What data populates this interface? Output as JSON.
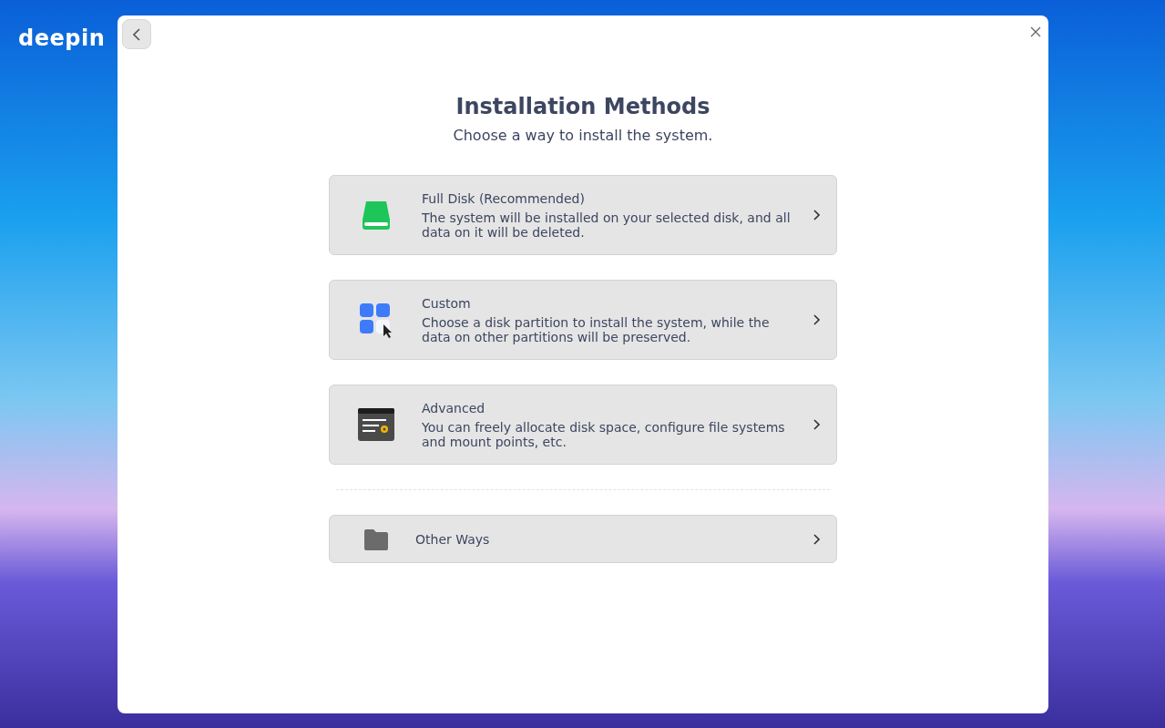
{
  "logo": {
    "text": "deepin"
  },
  "dialog": {
    "title": "Installation Methods",
    "subtitle": "Choose a way to install the system."
  },
  "methods": [
    {
      "kind": "disk",
      "title": "Full Disk (Recommended)",
      "description": "The system will be installed on your selected disk, and all data on it will be deleted."
    },
    {
      "kind": "apps",
      "title": "Custom",
      "description": "Choose a disk partition to install the system, while the data on other partitions will be preserved."
    },
    {
      "kind": "advanced",
      "title": "Advanced",
      "description": "You can freely allocate disk space, configure file systems and mount points, etc."
    }
  ],
  "other": {
    "kind": "folder",
    "title": "Other Ways"
  }
}
